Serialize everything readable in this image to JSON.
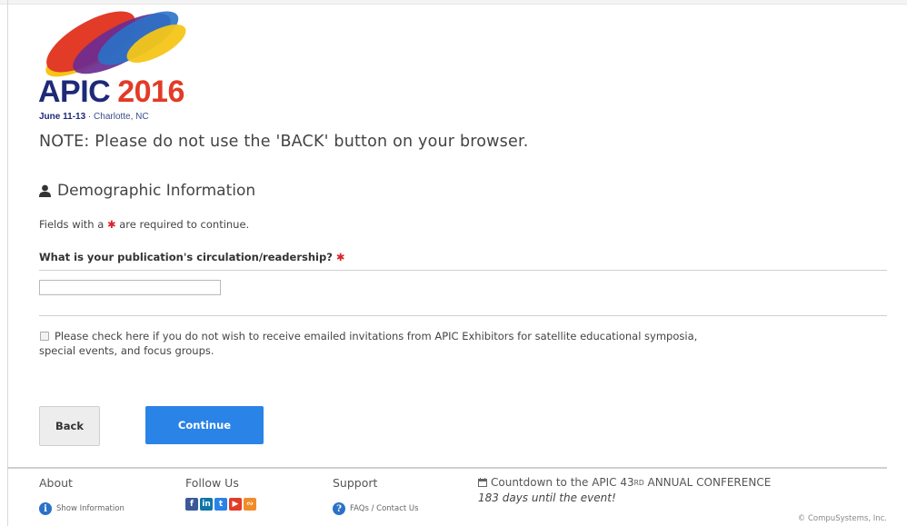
{
  "logo": {
    "name": "APIC",
    "year": "2016",
    "dates": "June 11-13",
    "location": "Charlotte, NC",
    "colors": [
      "#e23b27",
      "#f5c518",
      "#6b2c91",
      "#2a72c8",
      "#1e2a78"
    ]
  },
  "note": "NOTE: Please do not use the 'BACK' button on your browser.",
  "section": {
    "icon": "user-icon",
    "title": "Demographic Information"
  },
  "required_note": {
    "prefix": "Fields with a",
    "star": "✱",
    "suffix": "are required to continue."
  },
  "question": {
    "label": "What is your publication's circulation/readership?",
    "star": "✱",
    "value": "",
    "placeholder": ""
  },
  "optout": {
    "checked": false,
    "text": "Please check here if you do not wish to receive emailed invitations from APIC Exhibitors for satellite educational symposia, special events, and focus groups."
  },
  "buttons": {
    "back": "Back",
    "continue": "Continue",
    "continue_color": "#2a83e6"
  },
  "footer": {
    "about": {
      "heading": "About",
      "link": "Show Information",
      "icon": "info-icon"
    },
    "follow": {
      "heading": "Follow Us",
      "icons": [
        "facebook-icon",
        "linkedin-icon",
        "twitter-icon",
        "youtube-icon",
        "rss-icon"
      ]
    },
    "support": {
      "heading": "Support",
      "link": "FAQs / Contact Us",
      "icon": "question-icon"
    },
    "countdown": {
      "icon": "calendar-icon",
      "prefix": "Countdown to the APIC 43",
      "sup": "RD",
      "suffix": "ANNUAL CONFERENCE",
      "days": "183 days until the event!"
    },
    "copyright": "© CompuSystems, Inc."
  }
}
